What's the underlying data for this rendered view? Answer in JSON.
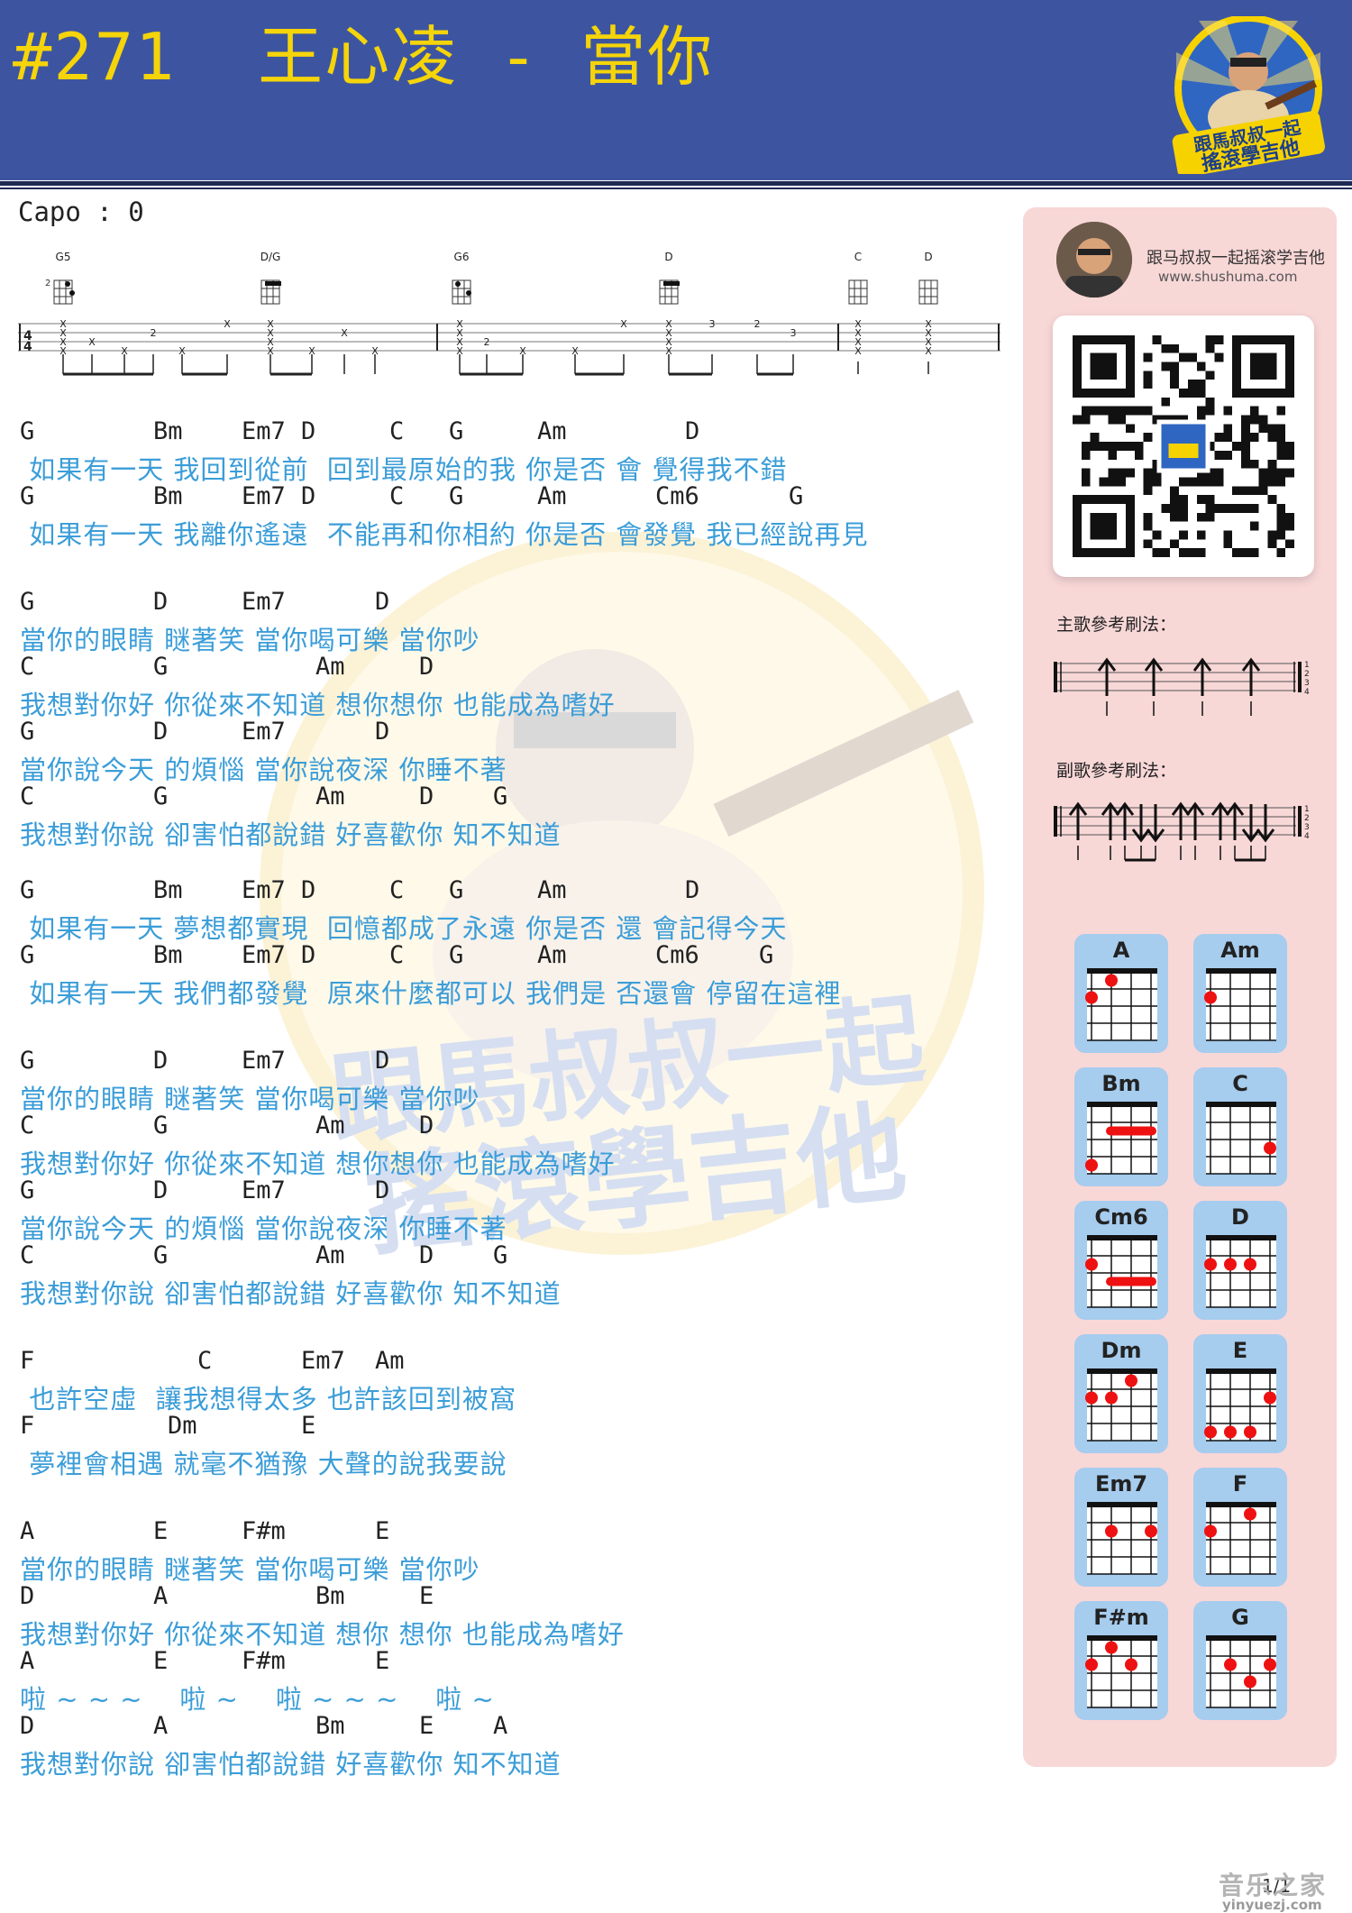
{
  "header": {
    "title": "#271  王心凌 - 當你",
    "logo_text": [
      "跟馬叔叔一起",
      "搖滾學吉他"
    ]
  },
  "capo": "Capo : 0",
  "tab": {
    "chords": [
      "G5",
      "D/G",
      "G6",
      "D",
      "C",
      "D"
    ],
    "fret_label": "2",
    "numbers": [
      "2",
      "2",
      "3",
      "2",
      "3"
    ]
  },
  "watermark": {
    "text": [
      "跟馬叔叔一起",
      "搖滾學吉他"
    ]
  },
  "song": [
    {
      "chords": [
        {
          "t": "G",
          "c": 0
        },
        {
          "t": "Bm",
          "c": 9
        },
        {
          "t": "Em7",
          "c": 15
        },
        {
          "t": "D",
          "c": 19
        },
        {
          "t": "C",
          "c": 25
        },
        {
          "t": "G",
          "c": 29
        },
        {
          "t": "Am",
          "c": 35
        },
        {
          "t": "D",
          "c": 45
        }
      ],
      "lyric": " 如果有一天 我回到從前  回到最原始的我 你是否 會 覺得我不錯"
    },
    {
      "chords": [
        {
          "t": "G",
          "c": 0
        },
        {
          "t": "Bm",
          "c": 9
        },
        {
          "t": "Em7",
          "c": 15
        },
        {
          "t": "D",
          "c": 19
        },
        {
          "t": "C",
          "c": 25
        },
        {
          "t": "G",
          "c": 29
        },
        {
          "t": "Am",
          "c": 35
        },
        {
          "t": "Cm6",
          "c": 43
        },
        {
          "t": "G",
          "c": 52
        }
      ],
      "lyric": " 如果有一天 我離你遙遠  不能再和你相約 你是否 會發覺 我已經說再見"
    },
    {
      "chords": [
        {
          "t": "G",
          "c": 0
        },
        {
          "t": "D",
          "c": 9
        },
        {
          "t": "Em7",
          "c": 15
        },
        {
          "t": "D",
          "c": 24
        }
      ],
      "lyric": "當你的眼睛 瞇著笑 當你喝可樂 當你吵"
    },
    {
      "chords": [
        {
          "t": "C",
          "c": 0
        },
        {
          "t": "G",
          "c": 9
        },
        {
          "t": "Am",
          "c": 20
        },
        {
          "t": "D",
          "c": 27
        }
      ],
      "lyric": "我想對你好 你從來不知道 想你想你 也能成為嗜好"
    },
    {
      "chords": [
        {
          "t": "G",
          "c": 0
        },
        {
          "t": "D",
          "c": 9
        },
        {
          "t": "Em7",
          "c": 15
        },
        {
          "t": "D",
          "c": 24
        }
      ],
      "lyric": "當你說今天 的煩惱 當你說夜深 你睡不著"
    },
    {
      "chords": [
        {
          "t": "C",
          "c": 0
        },
        {
          "t": "G",
          "c": 9
        },
        {
          "t": "Am",
          "c": 20
        },
        {
          "t": "D",
          "c": 27
        },
        {
          "t": "G",
          "c": 32
        }
      ],
      "lyric": "我想對你說 卻害怕都說錯 好喜歡你 知不知道"
    },
    {
      "chords": [
        {
          "t": "G",
          "c": 0
        },
        {
          "t": "Bm",
          "c": 9
        },
        {
          "t": "Em7",
          "c": 15
        },
        {
          "t": "D",
          "c": 19
        },
        {
          "t": "C",
          "c": 25
        },
        {
          "t": "G",
          "c": 29
        },
        {
          "t": "Am",
          "c": 35
        },
        {
          "t": "D",
          "c": 45
        }
      ],
      "lyric": " 如果有一天 夢想都實現  回憶都成了永遠 你是否 還 會記得今天"
    },
    {
      "chords": [
        {
          "t": "G",
          "c": 0
        },
        {
          "t": "Bm",
          "c": 9
        },
        {
          "t": "Em7",
          "c": 15
        },
        {
          "t": "D",
          "c": 19
        },
        {
          "t": "C",
          "c": 25
        },
        {
          "t": "G",
          "c": 29
        },
        {
          "t": "Am",
          "c": 35
        },
        {
          "t": "Cm6",
          "c": 43
        },
        {
          "t": "G",
          "c": 50
        }
      ],
      "lyric": " 如果有一天 我們都發覺  原來什麼都可以 我們是 否還會 停留在這裡"
    },
    {
      "chords": [
        {
          "t": "G",
          "c": 0
        },
        {
          "t": "D",
          "c": 9
        },
        {
          "t": "Em7",
          "c": 15
        },
        {
          "t": "D",
          "c": 24
        }
      ],
      "lyric": "當你的眼睛 瞇著笑 當你喝可樂 當你吵"
    },
    {
      "chords": [
        {
          "t": "C",
          "c": 0
        },
        {
          "t": "G",
          "c": 9
        },
        {
          "t": "Am",
          "c": 20
        },
        {
          "t": "D",
          "c": 27
        }
      ],
      "lyric": "我想對你好 你從來不知道 想你想你 也能成為嗜好"
    },
    {
      "chords": [
        {
          "t": "G",
          "c": 0
        },
        {
          "t": "D",
          "c": 9
        },
        {
          "t": "Em7",
          "c": 15
        },
        {
          "t": "D",
          "c": 24
        }
      ],
      "lyric": "當你說今天 的煩惱 當你說夜深 你睡不著"
    },
    {
      "chords": [
        {
          "t": "C",
          "c": 0
        },
        {
          "t": "G",
          "c": 9
        },
        {
          "t": "Am",
          "c": 20
        },
        {
          "t": "D",
          "c": 27
        },
        {
          "t": "G",
          "c": 32
        }
      ],
      "lyric": "我想對你說 卻害怕都說錯 好喜歡你 知不知道"
    },
    {
      "chords": [
        {
          "t": "F",
          "c": 0
        },
        {
          "t": "C",
          "c": 12
        },
        {
          "t": "Em7",
          "c": 19
        },
        {
          "t": "Am",
          "c": 24
        }
      ],
      "lyric": " 也許空虛  讓我想得太多 也許該回到被窩"
    },
    {
      "chords": [
        {
          "t": "F",
          "c": 0
        },
        {
          "t": "Dm",
          "c": 10
        },
        {
          "t": "E",
          "c": 19
        }
      ],
      "lyric": " 夢裡會相遇 就毫不猶豫 大聲的說我要說"
    },
    {
      "chords": [
        {
          "t": "A",
          "c": 0
        },
        {
          "t": "E",
          "c": 9
        },
        {
          "t": "F#m",
          "c": 15
        },
        {
          "t": "E",
          "c": 24
        }
      ],
      "lyric": "當你的眼睛 瞇著笑 當你喝可樂 當你吵"
    },
    {
      "chords": [
        {
          "t": "D",
          "c": 0
        },
        {
          "t": "A",
          "c": 9
        },
        {
          "t": "Bm",
          "c": 20
        },
        {
          "t": "E",
          "c": 27
        }
      ],
      "lyric": "我想對你好 你從來不知道 想你 想你 也能成為嗜好"
    },
    {
      "chords": [
        {
          "t": "A",
          "c": 0
        },
        {
          "t": "E",
          "c": 9
        },
        {
          "t": "F#m",
          "c": 15
        },
        {
          "t": "E",
          "c": 24
        }
      ],
      "lyric": "啦 ~ ~ ~    啦 ~    啦 ~ ~ ~    啦 ~"
    },
    {
      "chords": [
        {
          "t": "D",
          "c": 0
        },
        {
          "t": "A",
          "c": 9
        },
        {
          "t": "Bm",
          "c": 20
        },
        {
          "t": "E",
          "c": 27
        },
        {
          "t": "A",
          "c": 32
        }
      ],
      "lyric": "我想對你說 卻害怕都說錯 好喜歡你 知不知道"
    }
  ],
  "panel": {
    "name": "跟马叔叔一起摇滚学吉他",
    "url": "www.shushuma.com",
    "main_strum_label": "主歌參考刷法：",
    "chorus_strum_label": "副歌參考刷法：",
    "string_numbers": [
      "1",
      "2",
      "3",
      "4"
    ],
    "chord_cards": [
      {
        "name": "A",
        "dots": [
          [
            1,
            1
          ],
          [
            0,
            2
          ]
        ],
        "barre": null
      },
      {
        "name": "Am",
        "dots": [
          [
            0,
            2
          ]
        ],
        "barre": null
      },
      {
        "name": "Bm",
        "dots": [
          [
            0,
            4
          ]
        ],
        "barre": [
          1,
          3,
          2
        ]
      },
      {
        "name": "C",
        "dots": [
          [
            3,
            3
          ]
        ],
        "barre": null
      },
      {
        "name": "Cm6",
        "dots": [
          [
            0,
            2
          ]
        ],
        "barre": [
          1,
          3,
          3
        ]
      },
      {
        "name": "D",
        "dots": [
          [
            0,
            2
          ],
          [
            1,
            2
          ],
          [
            2,
            2
          ]
        ],
        "barre": null
      },
      {
        "name": "Dm",
        "dots": [
          [
            0,
            2
          ],
          [
            1,
            2
          ],
          [
            2,
            1
          ]
        ],
        "barre": null
      },
      {
        "name": "E",
        "dots": [
          [
            3,
            2
          ],
          [
            0,
            4
          ],
          [
            1,
            4
          ],
          [
            2,
            4
          ]
        ],
        "barre": null
      },
      {
        "name": "Em7",
        "dots": [
          [
            1,
            2
          ],
          [
            3,
            2
          ]
        ],
        "barre": null
      },
      {
        "name": "F",
        "dots": [
          [
            2,
            1
          ],
          [
            0,
            2
          ]
        ],
        "barre": null
      },
      {
        "name": "F#m",
        "dots": [
          [
            1,
            1
          ],
          [
            0,
            2
          ],
          [
            2,
            2
          ]
        ],
        "barre": null
      },
      {
        "name": "G",
        "dots": [
          [
            1,
            2
          ],
          [
            3,
            2
          ],
          [
            2,
            3
          ]
        ],
        "barre": null
      }
    ]
  },
  "footer": {
    "page": "1/1",
    "site_cn": "音乐之家",
    "site_url": "yinyuezj.com"
  },
  "colors": {
    "header": "#3d55a0",
    "title": "#f5d40a",
    "lyric": "#3b9dd8",
    "panel": "#f8d7d7",
    "card": "#a6ccee",
    "dot": "#ee1111"
  }
}
